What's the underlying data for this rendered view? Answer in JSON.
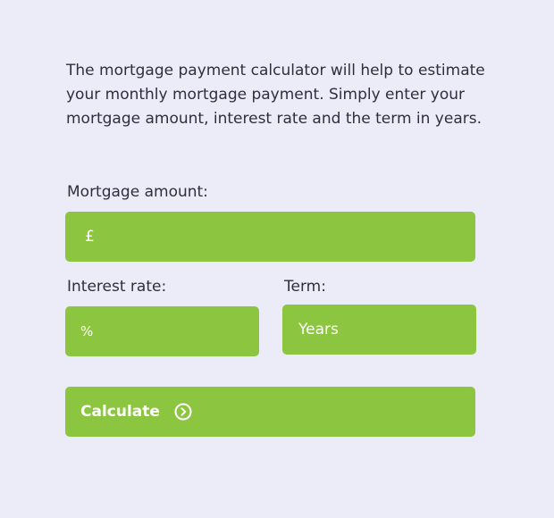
{
  "intro_text": "The mortgage payment calculator will help to estimate your monthly mortgage payment. Simply enter your mortgage amount, interest rate and the term in years.",
  "mortgage": {
    "label": "Mortgage amount:",
    "prefix": "£",
    "value": ""
  },
  "interest": {
    "label": "Interest rate:",
    "prefix": "%",
    "value": ""
  },
  "term": {
    "label": "Term:",
    "placeholder": "Years",
    "value": ""
  },
  "calculate": {
    "label": "Calculate",
    "icon": "chevron-right-circle-icon"
  },
  "colors": {
    "background": "#ececf8",
    "accent": "#8cc540",
    "text": "#2e2e3e"
  }
}
